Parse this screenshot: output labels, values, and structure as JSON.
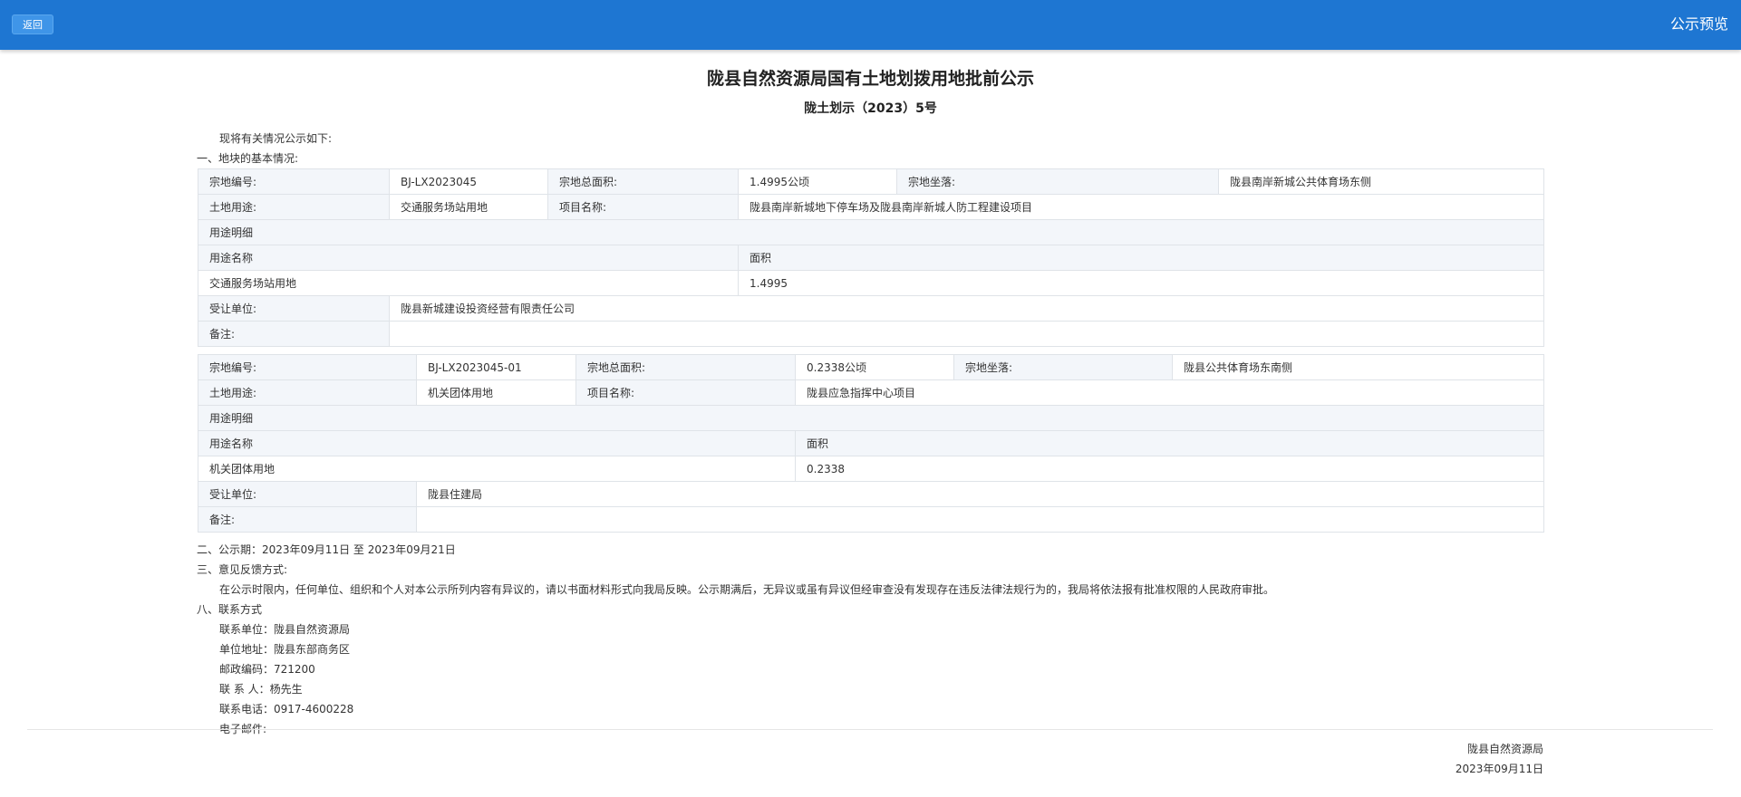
{
  "header": {
    "back_label": "返回",
    "page_title": "公示预览"
  },
  "doc": {
    "title": "陇县自然资源局国有土地划拨用地批前公示",
    "number": "陇土划示（2023）5号",
    "intro": "现将有关情况公示如下:",
    "section1": "一、地块的基本情况:",
    "labels": {
      "parcel_code": "宗地编号:",
      "total_area": "宗地总面积:",
      "location": "宗地坐落:",
      "land_use": "土地用途:",
      "project_name": "项目名称:",
      "use_detail": "用途明细",
      "use_name": "用途名称",
      "area": "面积",
      "assignee": "受让单位:",
      "remarks": "备注:"
    },
    "parcels": [
      {
        "code": "BJ-LX2023045",
        "total_area": "1.4995公顷",
        "location": "陇县南岸新城公共体育场东侧",
        "land_use": "交通服务场站用地",
        "project_name": "陇县南岸新城地下停车场及陇县南岸新城人防工程建设项目",
        "detail_use": "交通服务场站用地",
        "detail_area": "1.4995",
        "assignee": "陇县新城建设投资经营有限责任公司",
        "remarks": ""
      },
      {
        "code": "BJ-LX2023045-01",
        "total_area": "0.2338公顷",
        "location": "陇县公共体育场东南侧",
        "land_use": "机关团体用地",
        "project_name": "陇县应急指挥中心项目",
        "detail_use": "机关团体用地",
        "detail_area": "0.2338",
        "assignee": "陇县住建局",
        "remarks": ""
      }
    ],
    "section2": "二、公示期：2023年09月11日 至 2023年09月21日",
    "section3": "三、意见反馈方式:",
    "feedback": "在公示时限内，任何单位、组织和个人对本公示所列内容有异议的，请以书面材料形式向我局反映。公示期满后，无异议或虽有异议但经审查没有发现存在违反法律法规行为的，我局将依法报有批准权限的人民政府审批。",
    "section8": "八、联系方式",
    "contact": {
      "unit": "联系单位：陇县自然资源局",
      "address": "单位地址：陇县东部商务区",
      "postcode": "邮政编码：721200",
      "person": "联 系 人：杨先生",
      "phone": "联系电话：0917-4600228",
      "email": "电子邮件:"
    },
    "signature": {
      "org": "陇县自然资源局",
      "date": "2023年09月11日"
    }
  }
}
